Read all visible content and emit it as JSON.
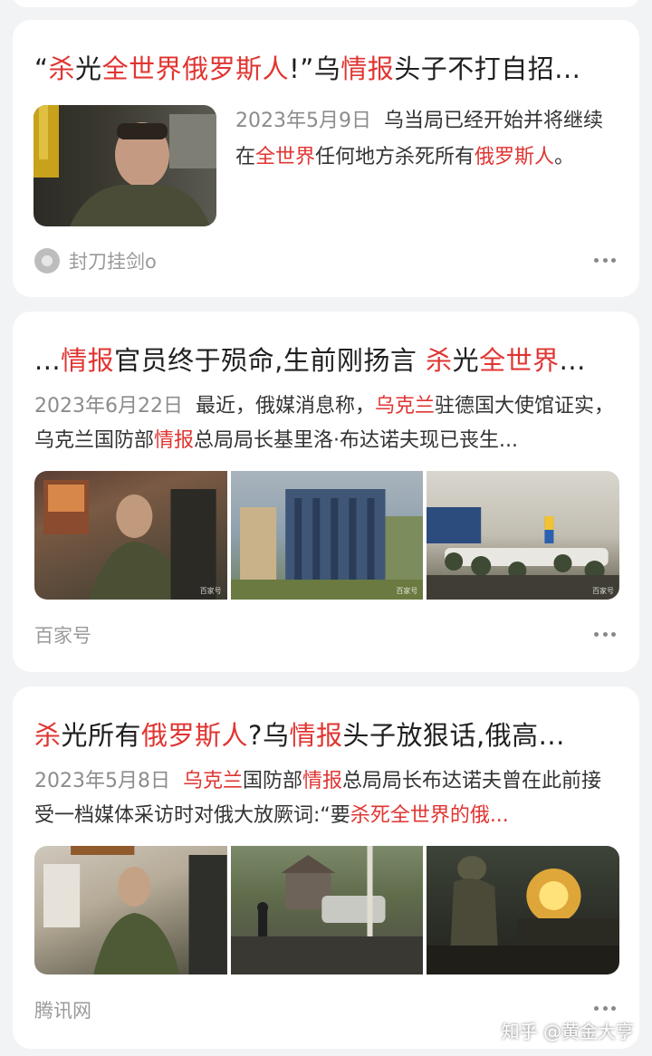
{
  "cards": [
    {
      "title_parts": [
        {
          "t": "“",
          "hl": false
        },
        {
          "t": "杀",
          "hl": true
        },
        {
          "t": "光",
          "hl": false
        },
        {
          "t": "全世界俄罗斯人",
          "hl": true
        },
        {
          "t": "!”乌",
          "hl": false
        },
        {
          "t": "情报",
          "hl": true
        },
        {
          "t": "头子不打自招...",
          "hl": false
        }
      ],
      "date": "2023年5月9日",
      "snippet_parts": [
        {
          "t": "乌当局已经开始并将继续在",
          "hl": false
        },
        {
          "t": "全世界",
          "hl": true
        },
        {
          "t": "任何地方杀死所有",
          "hl": false
        },
        {
          "t": "俄罗斯人",
          "hl": true
        },
        {
          "t": "。",
          "hl": false
        }
      ],
      "source": "封刀挂剑o"
    },
    {
      "title_parts": [
        {
          "t": "...",
          "hl": false
        },
        {
          "t": "情报",
          "hl": true
        },
        {
          "t": "官员终于殒命,生前刚扬言 ",
          "hl": false
        },
        {
          "t": "杀",
          "hl": true
        },
        {
          "t": "光",
          "hl": false
        },
        {
          "t": "全世界",
          "hl": true
        },
        {
          "t": "...",
          "hl": false
        }
      ],
      "date": "2023年6月22日",
      "snippet_parts": [
        {
          "t": "最近，俄媒消息称，",
          "hl": false
        },
        {
          "t": "乌克兰",
          "hl": true
        },
        {
          "t": "驻德国大使馆证实，乌克兰国防部",
          "hl": false
        },
        {
          "t": "情报",
          "hl": true
        },
        {
          "t": "总局局长基里洛·布达诺夫现已丧生...",
          "hl": false
        }
      ],
      "source": "百家号"
    },
    {
      "title_parts": [
        {
          "t": "杀",
          "hl": true
        },
        {
          "t": "光所有",
          "hl": false
        },
        {
          "t": "俄罗斯人",
          "hl": true
        },
        {
          "t": "?乌",
          "hl": false
        },
        {
          "t": "情报",
          "hl": true
        },
        {
          "t": "头子放狠话,俄高...",
          "hl": false
        }
      ],
      "date": "2023年5月8日",
      "snippet_parts": [
        {
          "t": "乌克兰",
          "hl": true
        },
        {
          "t": "国防部",
          "hl": false
        },
        {
          "t": "情报",
          "hl": true
        },
        {
          "t": "总局局长布达诺夫曾在此前接受一档媒体采访时对俄大放厥词:“要",
          "hl": false
        },
        {
          "t": "杀死全世界的俄...",
          "hl": true
        }
      ],
      "source": "腾讯网"
    }
  ],
  "watermark": "知乎 @黄金大亨",
  "icons": {
    "more": "more-dots-icon",
    "source_avatar": "source-avatar-icon"
  },
  "colors": {
    "highlight": "#e03532",
    "date": "#8c8c8c",
    "source": "#9a9a9a"
  }
}
